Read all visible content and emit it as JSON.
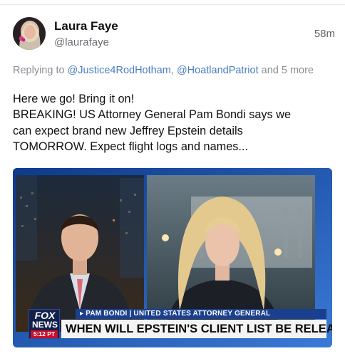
{
  "post": {
    "author": {
      "display_name": "Laura Faye",
      "handle": "@laurafaye"
    },
    "timestamp": "58m",
    "reply": {
      "prefix": "Replying to ",
      "mentions": [
        "@Justice4RodHotham",
        "@HoatlandPatriot"
      ],
      "separator": ", ",
      "suffix": " and 5 more"
    },
    "text_lines": [
      "Here we go! Bring it on!",
      "BREAKING! US Attorney General Pam Bondi says we",
      "can expect brand new Jeffrey Epstein details",
      "TOMORROW. Expect flight logs and names..."
    ],
    "media": {
      "chyron_top": "▸ PAM BONDI | UNITED STATES ATTORNEY GENERAL",
      "chyron_main": "WHEN WILL EPSTEIN'S CLIENT LIST BE RELEASED?",
      "logo_line1": "FOX",
      "logo_line2": "NEWS",
      "logo_time": "5:12 PT"
    }
  },
  "colors": {
    "mention": "#4a7fc1",
    "muted_text": "#8a8e94",
    "fox_blue": "#1a3f8f",
    "fox_red": "#c8102e"
  }
}
